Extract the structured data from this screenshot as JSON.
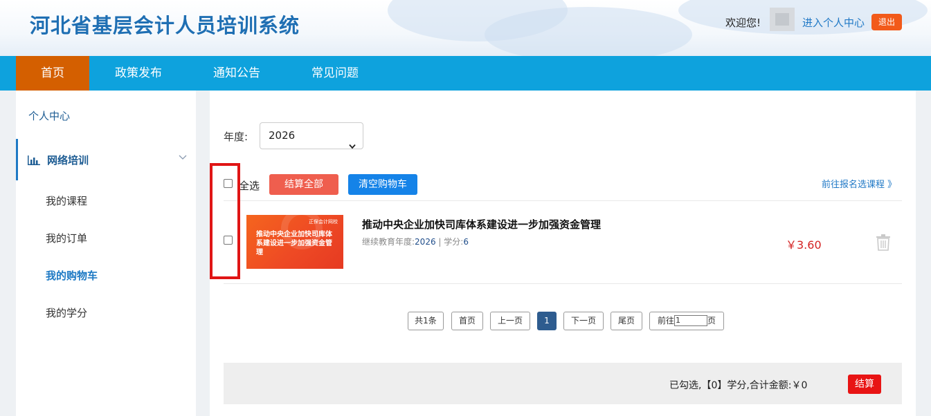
{
  "header": {
    "site_title": "河北省基层会计人员培训系统",
    "welcome": "欢迎您!",
    "enter_center": "进入个人中心",
    "logout": "退出"
  },
  "nav": {
    "items": [
      {
        "label": "首页",
        "active": true
      },
      {
        "label": "政策发布"
      },
      {
        "label": "通知公告"
      },
      {
        "label": "常见问题"
      }
    ]
  },
  "sidebar": {
    "top": "个人中心",
    "group_label": "网络培训",
    "items": [
      {
        "label": "我的课程"
      },
      {
        "label": "我的订单"
      },
      {
        "label": "我的购物车",
        "active": true
      },
      {
        "label": "我的学分"
      }
    ]
  },
  "filter": {
    "year_label": "年度:",
    "year_value": "2026"
  },
  "toolbar": {
    "select_all": "全选",
    "settle_all": "结算全部",
    "clear_cart": "清空购物车",
    "goto_enroll": "前往报名选课程 》"
  },
  "cart": {
    "items": [
      {
        "thumb_brand": "正保会计网校",
        "thumb_title": "推动中央企业加快司库体系建设进一步加强资金管理",
        "title": "推动中央企业加快司库体系建设进一步加强资金管理",
        "year_label": "继续教育年度:",
        "year": "2026",
        "sep": " | ",
        "credit_label": "学分:",
        "credit": "6",
        "price": "￥3.60"
      }
    ]
  },
  "pagination": {
    "total": "共1条",
    "first": "首页",
    "prev": "上一页",
    "current": "1",
    "next": "下一页",
    "last": "尾页",
    "goto_prefix": "前往",
    "goto_value": "1",
    "goto_suffix": "页"
  },
  "summary": {
    "text": "已勾选,【0】学分,合计金额:￥0",
    "settle": "结算"
  },
  "colors": {
    "nav_bg": "#0ea2dd",
    "nav_active": "#d45f00",
    "title_blue": "#1f6fb3",
    "price_red": "#d42323",
    "highlight_box": "#e01515"
  }
}
